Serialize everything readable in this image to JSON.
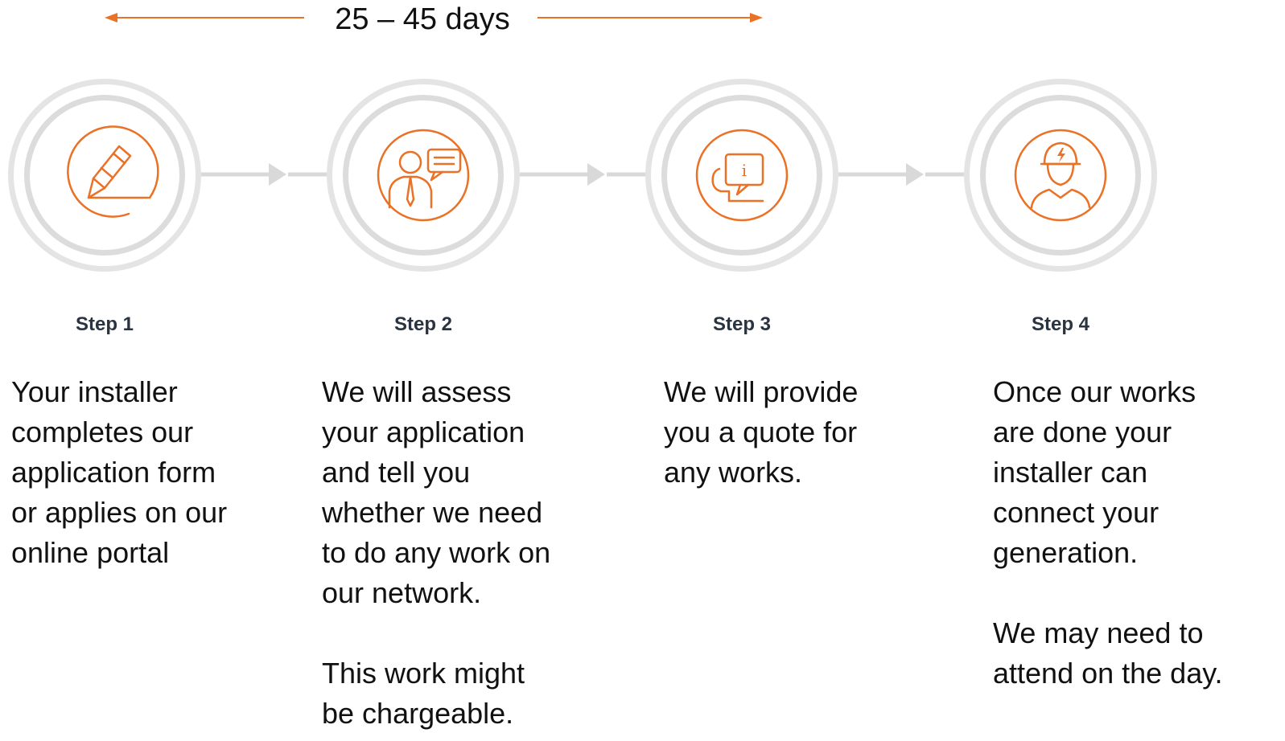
{
  "timeline": {
    "label": "25 – 45 days"
  },
  "colors": {
    "accent": "#ea7125",
    "ring": "#e0e0e0",
    "connector": "#d9d9d9"
  },
  "steps": [
    {
      "label": "Step 1",
      "icon": "pencil-edit-icon",
      "lines": [
        "Your installer",
        "completes our",
        "application form",
        "or applies on our",
        "online portal"
      ],
      "note_lines": []
    },
    {
      "label": "Step 2",
      "icon": "person-speech-icon",
      "lines": [
        "We will assess",
        "your application",
        "and tell you",
        "whether we need",
        "to do any work on",
        "our network."
      ],
      "note_lines": [
        "This work might",
        "be chargeable."
      ]
    },
    {
      "label": "Step 3",
      "icon": "info-chat-icon",
      "lines": [
        "We will provide",
        "you a quote for",
        "any works."
      ],
      "note_lines": []
    },
    {
      "label": "Step 4",
      "icon": "engineer-helmet-icon",
      "lines": [
        "Once our works",
        "are done your",
        "installer can",
        "connect your",
        "generation."
      ],
      "note_lines": [
        "We may need to",
        "attend on the day."
      ]
    }
  ]
}
